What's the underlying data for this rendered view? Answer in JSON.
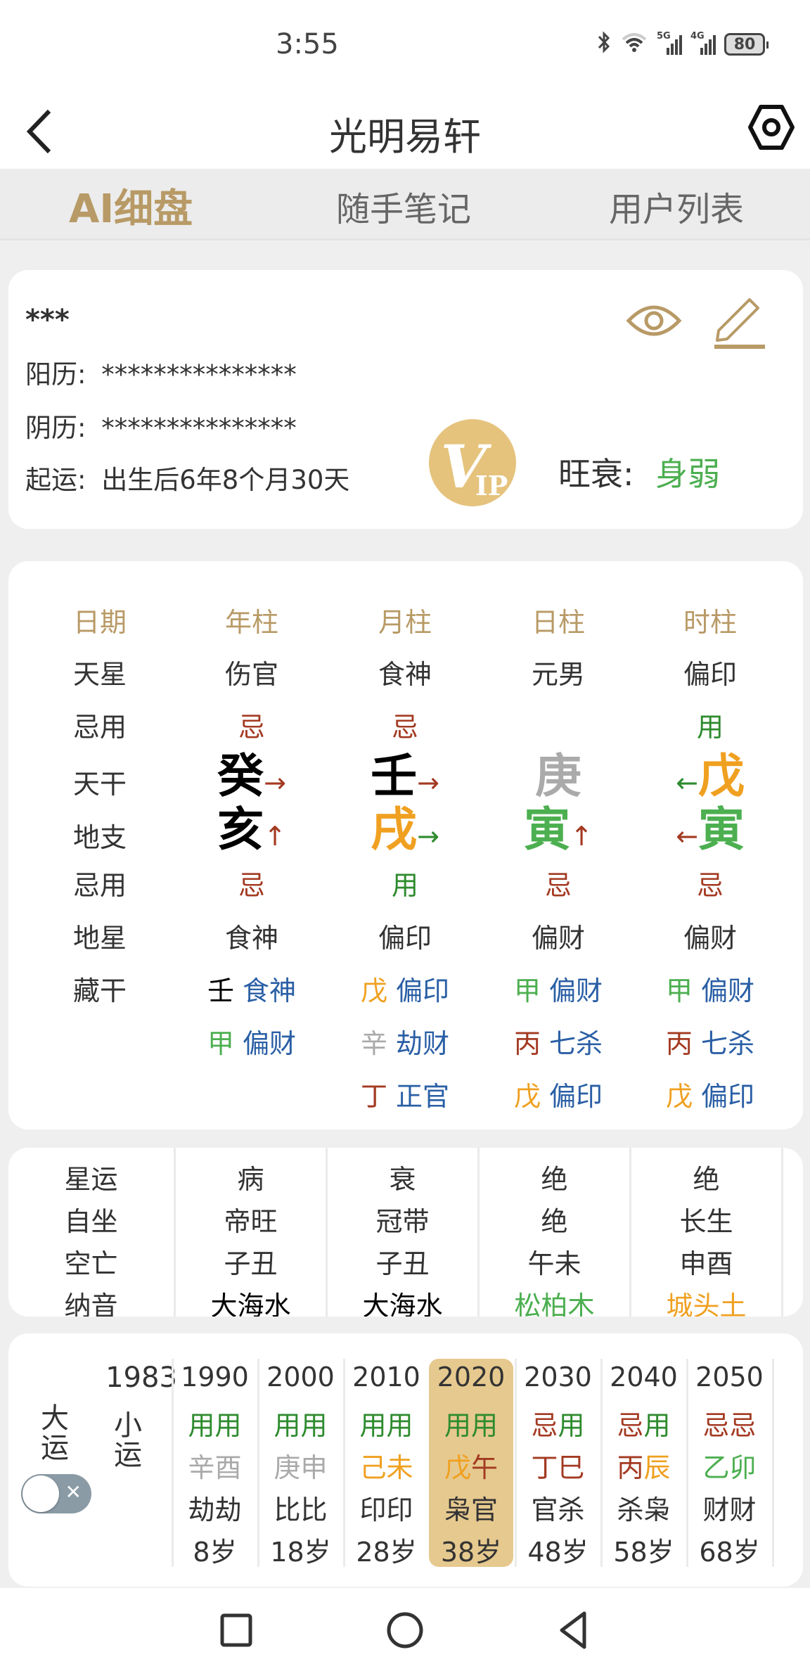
{
  "status_bar": {
    "time": "3:55",
    "battery": "80",
    "network1": "5G",
    "network2": "4G"
  },
  "header": {
    "title": "光明易轩"
  },
  "tabs": [
    {
      "label": "AI细盘",
      "active": true
    },
    {
      "label": "随手笔记",
      "active": false
    },
    {
      "label": "用户列表",
      "active": false
    }
  ],
  "info": {
    "name": "***",
    "solar_label": "阳历:",
    "solar_value": "***************",
    "lunar_label": "阴历:",
    "lunar_value": "***************",
    "luck_start_label": "起运:",
    "luck_start_value": "出生后6年8个月30天",
    "strength_label": "旺衰:",
    "strength_value": "身弱",
    "vip_badge": "VIP"
  },
  "pillars": {
    "headers": [
      "日期",
      "年柱",
      "月柱",
      "日柱",
      "时柱"
    ],
    "rows": {
      "tianxing": {
        "label": "天星",
        "values": [
          "伤官",
          "食神",
          "元男",
          "偏印"
        ]
      },
      "jiyong_top": {
        "label": "忌用",
        "values": [
          "忌",
          "忌",
          "",
          "用"
        ]
      },
      "tiangan": {
        "label": "天干",
        "values": [
          "癸",
          "壬",
          "庚",
          "戊"
        ],
        "arrows": [
          "→",
          "→",
          "",
          "←"
        ]
      },
      "dizhi": {
        "label": "地支",
        "values": [
          "亥",
          "戌",
          "寅",
          "寅"
        ],
        "arrows": [
          "↑",
          "→",
          "↑",
          "←"
        ]
      },
      "jiyong_bottom": {
        "label": "忌用",
        "values": [
          "忌",
          "用",
          "忌",
          "忌"
        ]
      },
      "dixing": {
        "label": "地星",
        "values": [
          "食神",
          "偏印",
          "偏财",
          "偏财"
        ]
      },
      "canggan": {
        "label": "藏干",
        "columns": [
          [
            {
              "stem": "壬",
              "god": "食神"
            },
            {
              "stem": "甲",
              "god": "偏财"
            }
          ],
          [
            {
              "stem": "戊",
              "god": "偏印"
            },
            {
              "stem": "辛",
              "god": "劫财"
            },
            {
              "stem": "丁",
              "god": "正官"
            }
          ],
          [
            {
              "stem": "甲",
              "god": "偏财"
            },
            {
              "stem": "丙",
              "god": "七杀"
            },
            {
              "stem": "戊",
              "god": "偏印"
            }
          ],
          [
            {
              "stem": "甲",
              "god": "偏财"
            },
            {
              "stem": "丙",
              "god": "七杀"
            },
            {
              "stem": "戊",
              "god": "偏印"
            }
          ]
        ]
      }
    }
  },
  "stars": {
    "labels": [
      "星运",
      "自坐",
      "空亡",
      "纳音"
    ],
    "columns": [
      [
        "病",
        "帝旺",
        "子丑",
        "大海水"
      ],
      [
        "衰",
        "冠带",
        "子丑",
        "大海水"
      ],
      [
        "绝",
        "绝",
        "午未",
        "松柏木"
      ],
      [
        "绝",
        "长生",
        "申酉",
        "城头土"
      ]
    ]
  },
  "luck": {
    "dayun_label": "大运",
    "xiaoyun_label": "小运",
    "start_year": "1983",
    "toggle_on": false,
    "columns": [
      {
        "year": "1990",
        "jy": [
          "用",
          "用"
        ],
        "gz": [
          "辛",
          "酉"
        ],
        "gods": "劫劫",
        "age": "8岁"
      },
      {
        "year": "2000",
        "jy": [
          "用",
          "用"
        ],
        "gz": [
          "庚",
          "申"
        ],
        "gods": "比比",
        "age": "18岁"
      },
      {
        "year": "2010",
        "jy": [
          "用",
          "用"
        ],
        "gz": [
          "己",
          "未"
        ],
        "gods": "印印",
        "age": "28岁"
      },
      {
        "year": "2020",
        "jy": [
          "用",
          "用"
        ],
        "gz": [
          "戊",
          "午"
        ],
        "gods": "枭官",
        "age": "38岁",
        "current": true
      },
      {
        "year": "2030",
        "jy": [
          "忌",
          "用"
        ],
        "gz": [
          "丁",
          "巳"
        ],
        "gods": "官杀",
        "age": "48岁"
      },
      {
        "year": "2040",
        "jy": [
          "忌",
          "用"
        ],
        "gz": [
          "丙",
          "辰"
        ],
        "gods": "杀枭",
        "age": "58岁"
      },
      {
        "year": "2050",
        "jy": [
          "忌",
          "忌"
        ],
        "gz": [
          "乙",
          "卯"
        ],
        "gods": "财财",
        "age": "68岁"
      }
    ]
  },
  "colors": {
    "accent_gold": "#b89a66",
    "ji_red": "#a33a22",
    "yong_green": "#2e8b2e",
    "wood_green": "#4caf50",
    "earth_orange": "#f0a020",
    "metal_gray": "#aaaaaa",
    "water_black": "#000000",
    "fire_red": "#a33a22",
    "god_blue": "#2a5fa5",
    "current_highlight": "#e6c98f"
  },
  "element_colors": {
    "甲": "#4caf50",
    "乙": "#4caf50",
    "寅": "#4caf50",
    "卯": "#4caf50",
    "丙": "#a33a22",
    "丁": "#a33a22",
    "巳": "#a33a22",
    "午": "#a33a22",
    "戊": "#f0a020",
    "己": "#f0a020",
    "辰": "#f0a020",
    "戌": "#f0a020",
    "未": "#f0a020",
    "丑": "#f0a020",
    "庚": "#aaaaaa",
    "辛": "#aaaaaa",
    "申": "#aaaaaa",
    "酉": "#aaaaaa",
    "壬": "#000000",
    "癸": "#000000",
    "亥": "#000000",
    "子": "#000000",
    "忌": "#a33a22",
    "用": "#2e8b2e"
  },
  "arrow_colors": {
    "tiangan": [
      "#a33a22",
      "#a33a22",
      "",
      "#2e8b2e"
    ],
    "dizhi": [
      "#a33a22",
      "#2e8b2e",
      "#a33a22",
      "#a33a22"
    ]
  },
  "nayin_colors": [
    "#000000",
    "#000000",
    "#4caf50",
    "#f0a020"
  ]
}
